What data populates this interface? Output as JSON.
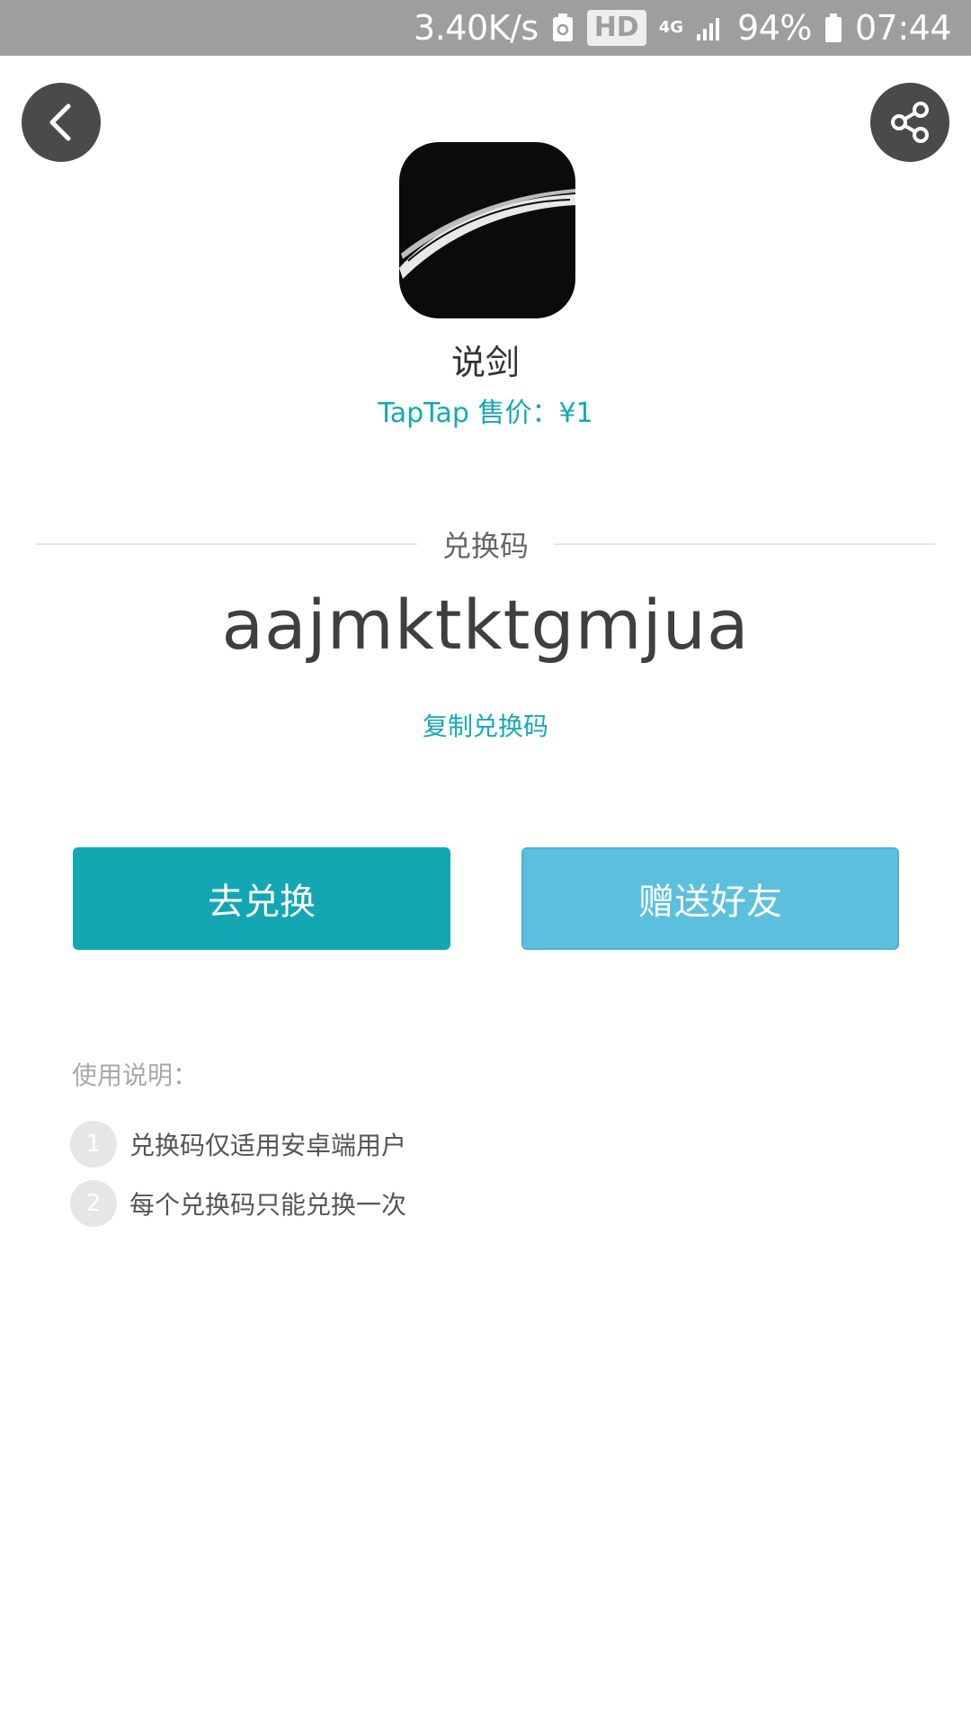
{
  "status_bar": {
    "network_speed": "3.40K/s",
    "hd_label": "HD",
    "network_type": "4G",
    "battery": "94%",
    "time": "07:44"
  },
  "header": {
    "back_icon": "chevron-left-icon",
    "share_icon": "share-icon"
  },
  "app": {
    "name": "说剑",
    "price": "TapTap 售价：¥1"
  },
  "redeem": {
    "section_label": "兑换码",
    "code": "aajmktktgmjua",
    "copy_label": "复制兑换码"
  },
  "actions": {
    "redeem_label": "去兑换",
    "gift_label": "赠送好友"
  },
  "instructions": {
    "title": "使用说明：",
    "rules": [
      {
        "num": "1",
        "text": "兑换码仅适用安卓端用户"
      },
      {
        "num": "2",
        "text": "每个兑换码只能兑换一次"
      }
    ]
  },
  "colors": {
    "accent": "#15a9b5",
    "redeem_button": "#12a7b3",
    "gift_button": "#5bc0de",
    "status_bar": "#9e9e9e"
  }
}
